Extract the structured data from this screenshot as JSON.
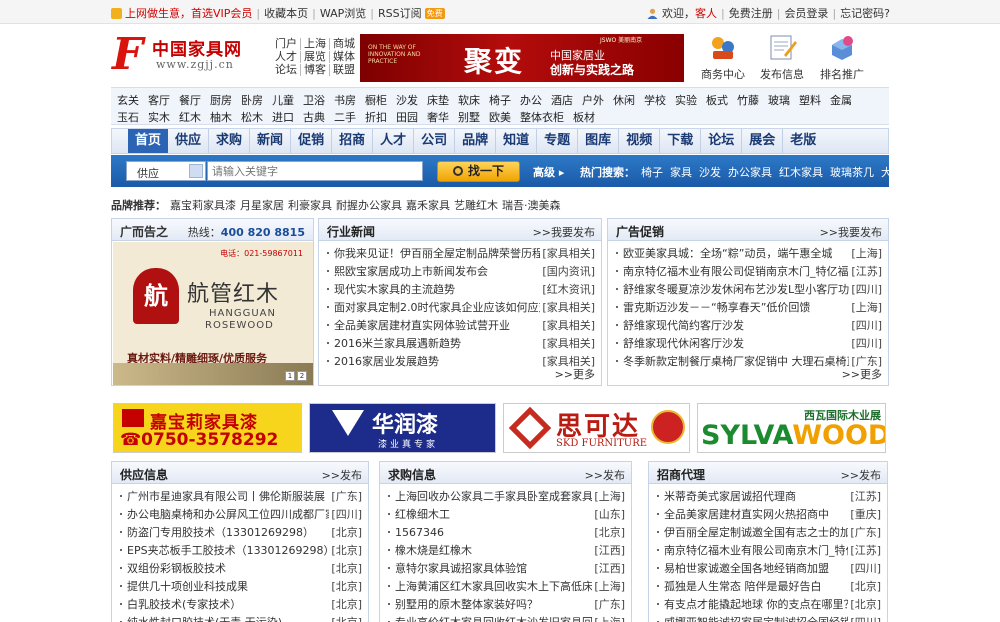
{
  "topbar": {
    "promo": "上网做生意，首选VIP会员",
    "links": [
      "收藏本页",
      "WAP浏览",
      "RSS订阅"
    ],
    "free_badge": "免费",
    "welcome": "欢迎，",
    "guest": "客人",
    "user_links": [
      "免费注册",
      "会员登录",
      "忘记密码?"
    ]
  },
  "logo": {
    "letter": "F",
    "name": "中国家具网",
    "url": "www.zgjj.cn"
  },
  "channels": [
    "门户",
    "上海",
    "商城",
    "人才",
    "展览",
    "媒体",
    "论坛",
    "博客",
    "联盟"
  ],
  "banner": {
    "en": "ON THE WAY OF INNOVATION AND PRACTICE",
    "big": "聚变",
    "line1": "中国家居业",
    "line2": "创新与实践之路",
    "strip": "JSWO 美丽南京"
  },
  "header_icons": [
    {
      "label": "商务中心",
      "icon": "business-center-icon"
    },
    {
      "label": "发布信息",
      "icon": "publish-info-icon"
    },
    {
      "label": "排名推广",
      "icon": "ranking-promotion-icon"
    }
  ],
  "categories": {
    "row1": [
      "玄关",
      "客厅",
      "餐厅",
      "厨房",
      "卧房",
      "儿童",
      "卫浴",
      "书房",
      "橱柜",
      "沙发",
      "床垫",
      "软床",
      "椅子",
      "办公",
      "酒店",
      "户外",
      "休闲",
      "学校",
      "实验",
      "板式",
      "竹藤",
      "玻璃",
      "塑料",
      "金属"
    ],
    "row2": [
      "玉石",
      "实木",
      "红木",
      "柚木",
      "松木",
      "进口",
      "古典",
      "二手",
      "折扣",
      "田园",
      "奢华",
      "别墅",
      "欧美",
      "整体衣柜",
      "板材"
    ]
  },
  "nav": [
    "首页",
    "供应",
    "求购",
    "新闻",
    "促销",
    "招商",
    "人才",
    "公司",
    "品牌",
    "知道",
    "专题",
    "图库",
    "视频",
    "下载",
    "论坛",
    "展会",
    "老版"
  ],
  "search": {
    "category": "供应",
    "placeholder": "请输入关键字",
    "button": "找一下",
    "advanced": "高级",
    "hot_label": "热门搜索：",
    "hot_words": [
      "椅子",
      "家具",
      "沙发",
      "办公家具",
      "红木家具",
      "玻璃茶几",
      "大班"
    ]
  },
  "brands": {
    "label": "品牌推荐：",
    "items": [
      "嘉宝莉家具漆",
      "月星家居",
      "利豪家具",
      "耐握办公家具",
      "嘉禾家具",
      "艺雕红木",
      "瑞吾·澳美森"
    ]
  },
  "ad_box": {
    "title": "广而告之",
    "hot_label": "热线：",
    "hotline": "400 820 8815",
    "tel": "电话：021-59867011",
    "seal_char": "航",
    "brand_cn": "航管红木",
    "brand_en1": "HANGGUAN",
    "brand_en2": "ROSEWOOD",
    "slogan": "真材实料/精雕细琢/优质服务",
    "dots": [
      "1",
      "2"
    ]
  },
  "news": {
    "title": "行业新闻",
    "more": ">>我要发布",
    "foot": ">>更多",
    "items": [
      {
        "text": "你我来见证！伊百丽全屋定制品牌荣誉历程",
        "tag": "[家具相关]"
      },
      {
        "text": "熙欧宝家居成功上市新闻发布会",
        "tag": "[国内资讯]"
      },
      {
        "text": "现代实木家具的主流趋势",
        "tag": "[红木资讯]"
      },
      {
        "text": "面对家具定制2.0时代家具企业应该如何应对",
        "tag": "[家具相关]"
      },
      {
        "text": "全品美家居建材直实网体验试营开业",
        "tag": "[家具相关]"
      },
      {
        "text": "2016米兰家具展遇新趋势",
        "tag": "[家具相关]"
      },
      {
        "text": "2016家居业发展趋势",
        "tag": "[家具相关]"
      }
    ]
  },
  "promo": {
    "title": "广告促销",
    "more": ">>我要发布",
    "foot": ">>更多",
    "items": [
      {
        "text": "欧亚美家具城：全场“粽”动员，端午惠全城",
        "tag": "[上海]"
      },
      {
        "text": "南京特亿福木业有限公司促销南京木门_特亿福原木",
        "tag": "[江苏]"
      },
      {
        "text": "舒维家冬暖夏凉沙发休闲布艺沙发L型小客厅功能沙",
        "tag": "[四川]"
      },
      {
        "text": "雷克斯迈沙发－－“畅享春天”低价回馈",
        "tag": "[上海]"
      },
      {
        "text": "舒维家现代简约客厅沙发",
        "tag": "[四川]"
      },
      {
        "text": "舒维家现代休闲客厅沙发",
        "tag": "[四川]"
      },
      {
        "text": "冬季新款定制餐厅桌椅厂家促销中 大理石桌椅直销",
        "tag": "[广东]"
      }
    ]
  },
  "logo_ads": {
    "ad1": {
      "name": "嘉宝莉家具漆",
      "phone": "☎0750-3578292"
    },
    "ad2": {
      "name": "华润漆",
      "slogan": "漆业真专家"
    },
    "ad3": {
      "name": "思可达",
      "en": "SKD FURNITURE"
    },
    "ad4": {
      "top": "西瓦国际木业展",
      "brand_a": "SYLVA",
      "brand_b": "WOOD"
    }
  },
  "supply": {
    "title": "供应信息",
    "more": ">>发布",
    "items": [
      {
        "text": "广州市星迪家具有限公司丨佛伦斯服装展",
        "tag": "[广东]"
      },
      {
        "text": "办公电脑桌椅和办公屏风工位四川成都厂家3",
        "tag": "[四川]"
      },
      {
        "text": "防盗门专用胶技术（13301269298）",
        "tag": "[北京]"
      },
      {
        "text": "EPS夹芯板手工胶技术（13301269298）",
        "tag": "[北京]"
      },
      {
        "text": "双组份彩钢板胶技术",
        "tag": "[北京]"
      },
      {
        "text": "提供几十项创业科技成果",
        "tag": "[北京]"
      },
      {
        "text": "白乳胶技术(专家技术）",
        "tag": "[北京]"
      },
      {
        "text": "纯水性封口胶技术(无毒,无污染)",
        "tag": "[北京]"
      }
    ]
  },
  "demand": {
    "title": "求购信息",
    "more": ">>发布",
    "items": [
      {
        "text": "上海回收办公家具二手家具卧室成套家具",
        "tag": "[上海]"
      },
      {
        "text": "红橡细木工",
        "tag": "[山东]"
      },
      {
        "text": "1567346",
        "tag": "[北京]"
      },
      {
        "text": "橡木烧是红橡木",
        "tag": "[江西]"
      },
      {
        "text": "意特尔家具诚招家具体验馆",
        "tag": "[江西]"
      },
      {
        "text": "上海黄浦区红木家具回收实木上下高低床估古",
        "tag": "[上海]"
      },
      {
        "text": "别墅用的原木整体家装好吗？",
        "tag": "[广东]"
      },
      {
        "text": "专业高价红木家具回收红木沙发旧家具回收上海老",
        "tag": "[上海]"
      }
    ]
  },
  "invest": {
    "title": "招商代理",
    "more": ">>发布",
    "items": [
      {
        "text": "米蒂奇美式家居诚招代理商",
        "tag": "[江苏]"
      },
      {
        "text": "全品美家居建材直实网火热招商中",
        "tag": "[重庆]"
      },
      {
        "text": "伊百丽全屋定制诚邀全国有志之士的加盟",
        "tag": "[广东]"
      },
      {
        "text": "南京特亿福木业有限公司南京木门_特亿福",
        "tag": "[江苏]"
      },
      {
        "text": "易柏世家诚邀全国各地经销商加盟",
        "tag": "[四川]"
      },
      {
        "text": "孤独是人生常态 陪伴是最好告白",
        "tag": "[北京]"
      },
      {
        "text": "有支点才能撬起地球 你的支点在哪里？",
        "tag": "[北京]"
      },
      {
        "text": "威娜亚智能诚招家居定制诚招全国经销加盟",
        "tag": "[四川]"
      }
    ]
  }
}
